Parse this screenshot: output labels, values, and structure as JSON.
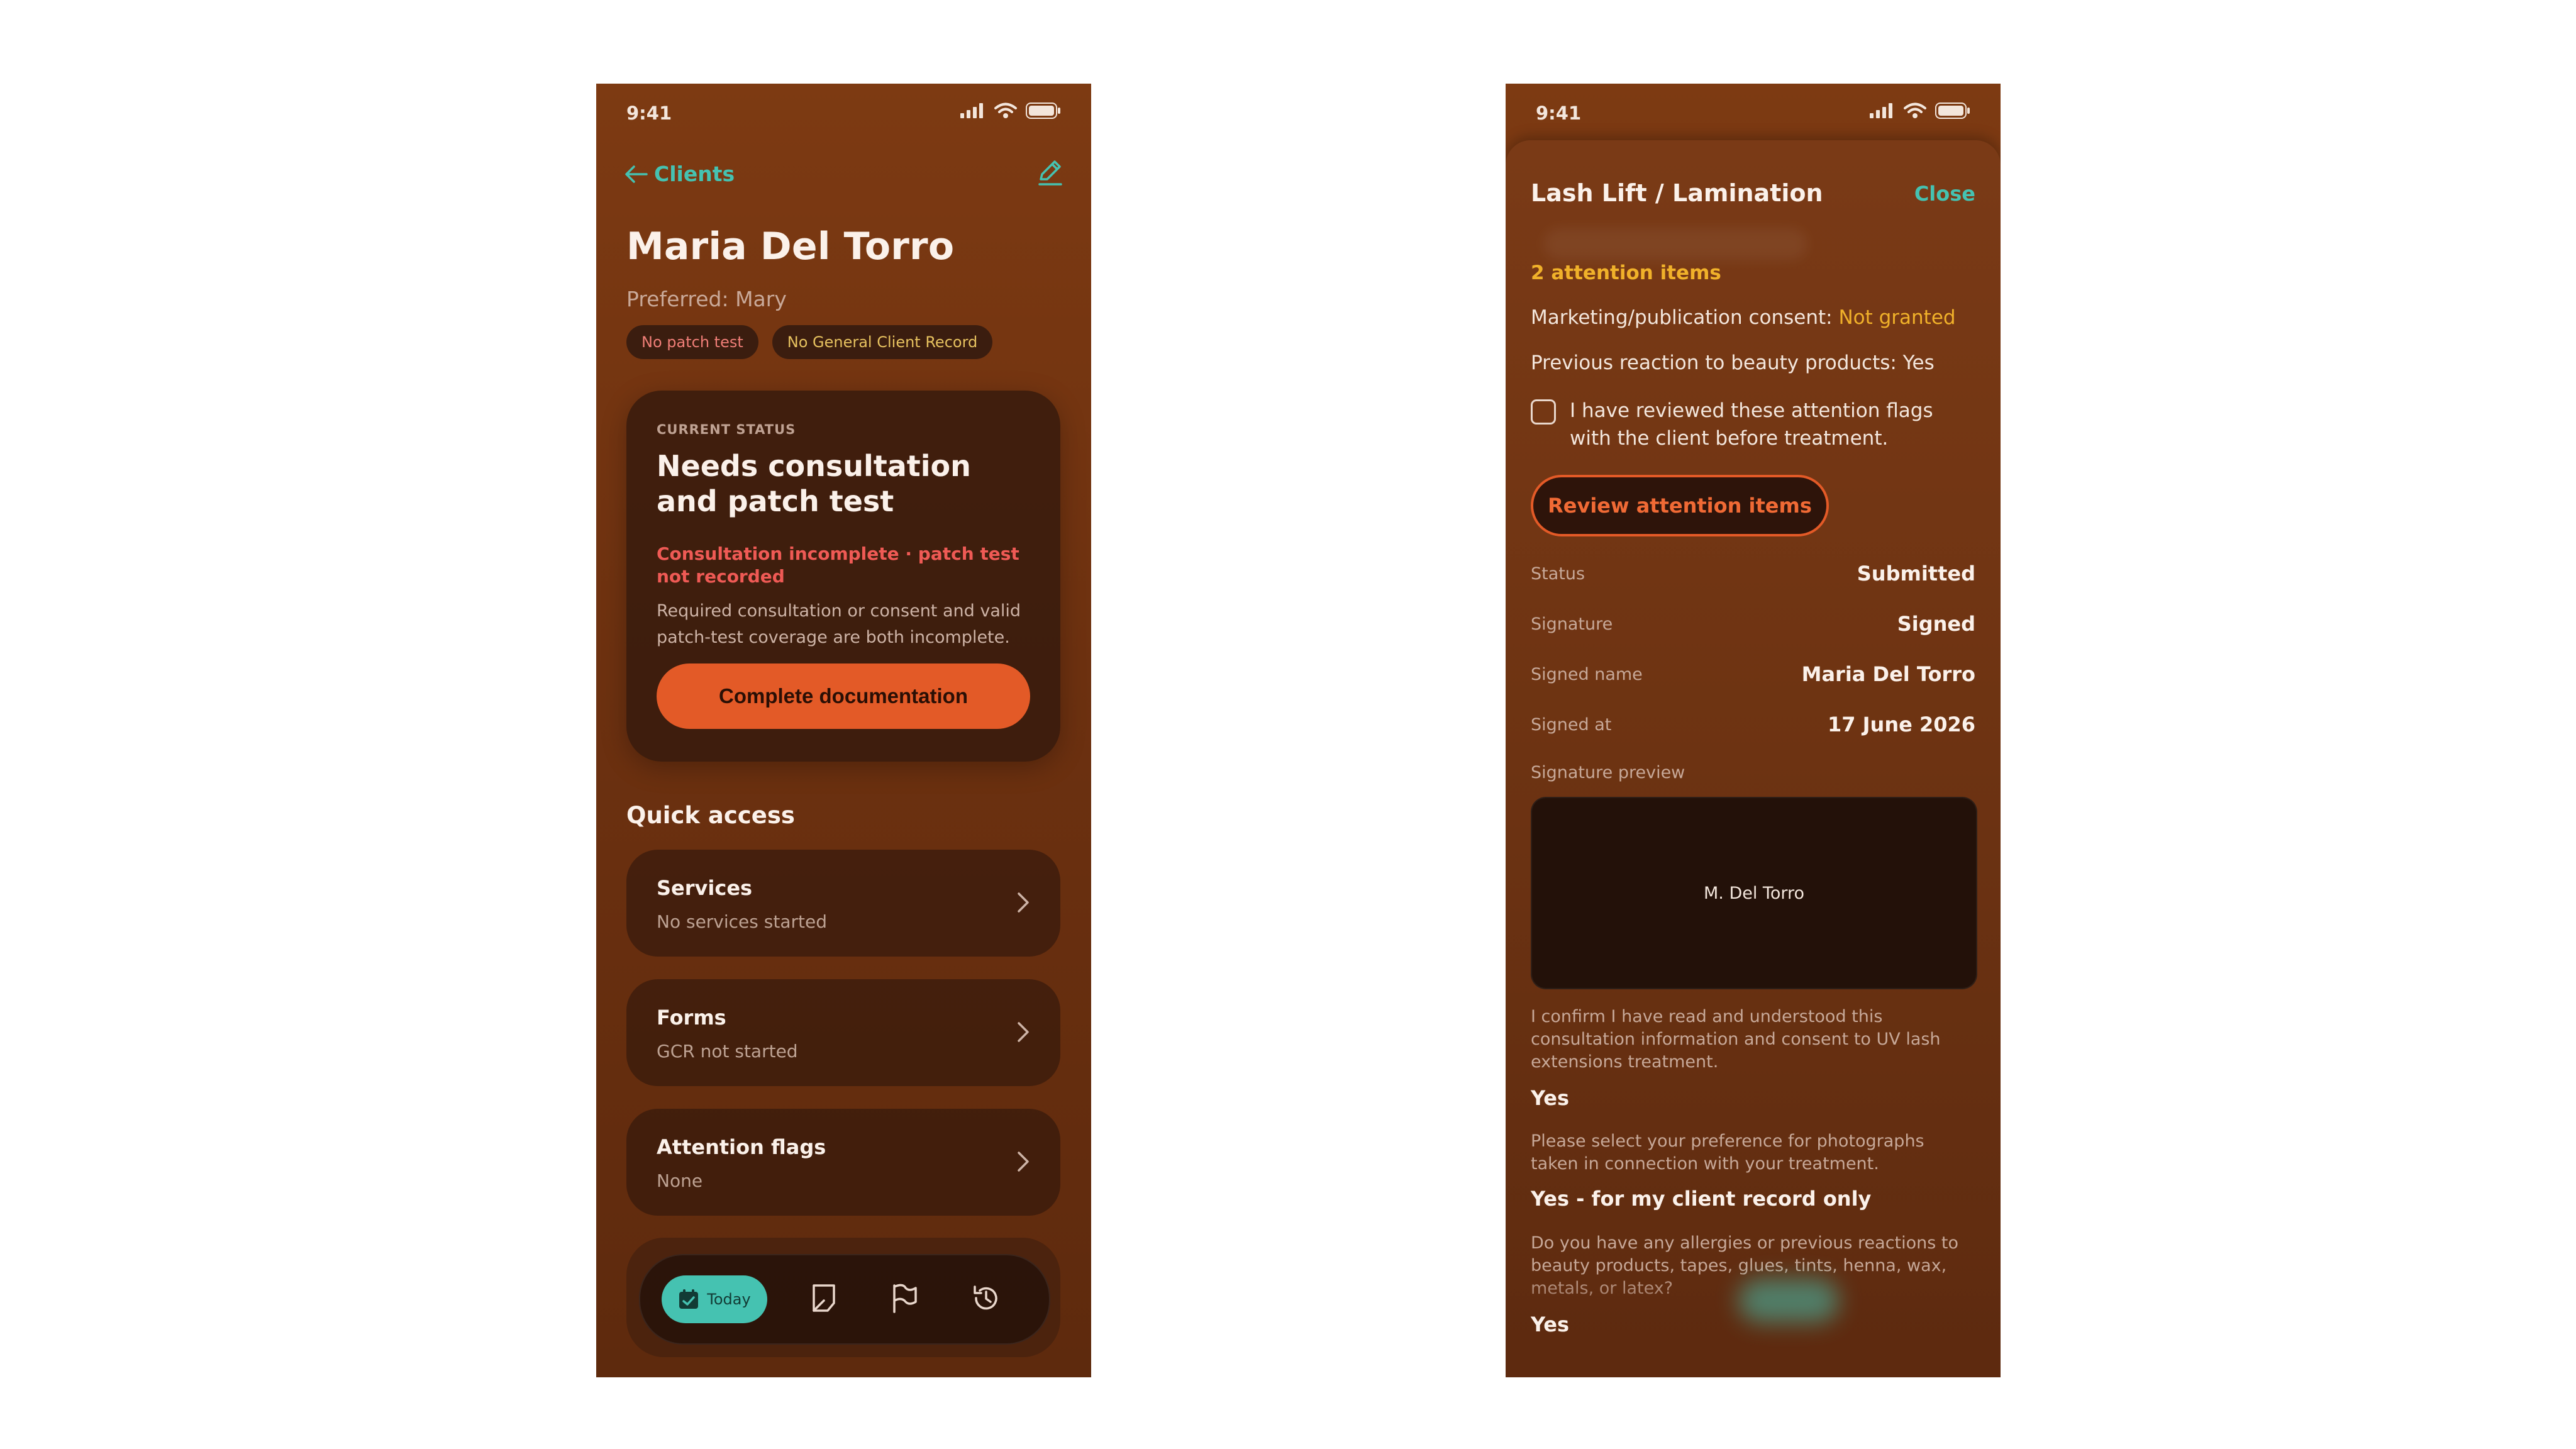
{
  "status_bar": {
    "time": "9:41"
  },
  "left": {
    "back_label": "Clients",
    "client_name": "Maria Del Torro",
    "preferred": "Preferred: Mary",
    "chips": [
      "No patch test",
      "No General Client Record"
    ],
    "status_card": {
      "kicker": "CURRENT STATUS",
      "headline": "Needs consultation and patch test",
      "alert": "Consultation incomplete · patch test not recorded",
      "description": "Required consultation or consent and valid patch-test coverage are both incomplete.",
      "button_label": "Complete documentation"
    },
    "quick_access": {
      "title": "Quick access",
      "items": [
        {
          "title": "Services",
          "subtitle": "No services started"
        },
        {
          "title": "Forms",
          "subtitle": "GCR not started"
        },
        {
          "title": "Attention flags",
          "subtitle": "None"
        }
      ]
    },
    "tabbar": {
      "today_label": "Today"
    }
  },
  "right": {
    "sheet_title": "Lash Lift / Lamination",
    "close_label": "Close",
    "attention_count": "2 attention items",
    "marketing_label": "Marketing/publication consent: ",
    "marketing_value": "Not granted",
    "previous_reaction": "Previous reaction to beauty products: Yes",
    "checkbox_label": "I have reviewed these attention flags with the client before treatment.",
    "review_button": "Review attention items",
    "details": [
      {
        "label": "Status",
        "value": "Submitted"
      },
      {
        "label": "Signature",
        "value": "Signed"
      },
      {
        "label": "Signed name",
        "value": "Maria Del Torro"
      },
      {
        "label": "Signed at",
        "value": "17 June 2026"
      }
    ],
    "signature_preview_label": "Signature preview",
    "signature_text": "M. Del Torro",
    "qa": [
      {
        "question": "I confirm I have read and understood this consultation information and consent to UV lash extensions treatment.",
        "answer": "Yes"
      },
      {
        "question": "Please select your preference for photographs taken in connection with your treatment.",
        "answer": "Yes - for my client record only"
      },
      {
        "question": "Do you have any allergies or previous reactions to beauty products, tapes, glues, tints, henna, wax, metals, or latex?",
        "answer": "Yes"
      }
    ]
  },
  "colors": {
    "accent_teal": "#45c2b1",
    "primary_orange": "#e35a27",
    "warning_yellow": "#f0b12a",
    "alert_red": "#ef5a55"
  }
}
